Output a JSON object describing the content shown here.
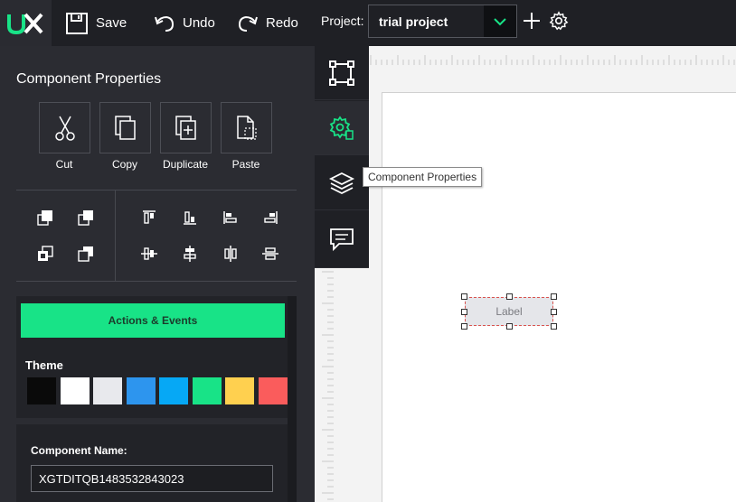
{
  "toolbar": {
    "save_label": "Save",
    "undo_label": "Undo",
    "redo_label": "Redo",
    "project_label": "Project:",
    "project_value": "trial project"
  },
  "panel": {
    "title": "Component Properties",
    "actions": [
      {
        "label": "Cut",
        "icon": "scissors-icon"
      },
      {
        "label": "Copy",
        "icon": "copy-icon"
      },
      {
        "label": "Duplicate",
        "icon": "duplicate-icon"
      },
      {
        "label": "Paste",
        "icon": "paste-icon"
      }
    ],
    "actions_events_label": "Actions & Events",
    "theme_label": "Theme",
    "theme_colors": [
      "#0a0a0a",
      "#ffffff",
      "#e8e9ed",
      "#2d95ee",
      "#06a8f5",
      "#18e387",
      "#ffd04f",
      "#fa5c5c"
    ],
    "component_name_label": "Component Name:",
    "component_name_value": "XGTDITQB1483532843023"
  },
  "side_tabs": {
    "tooltip": "Component Properties"
  },
  "canvas": {
    "label_text": "Label"
  },
  "colors": {
    "accent": "#18e387",
    "topbar": "#1f2025",
    "panel": "#2b2c32"
  }
}
